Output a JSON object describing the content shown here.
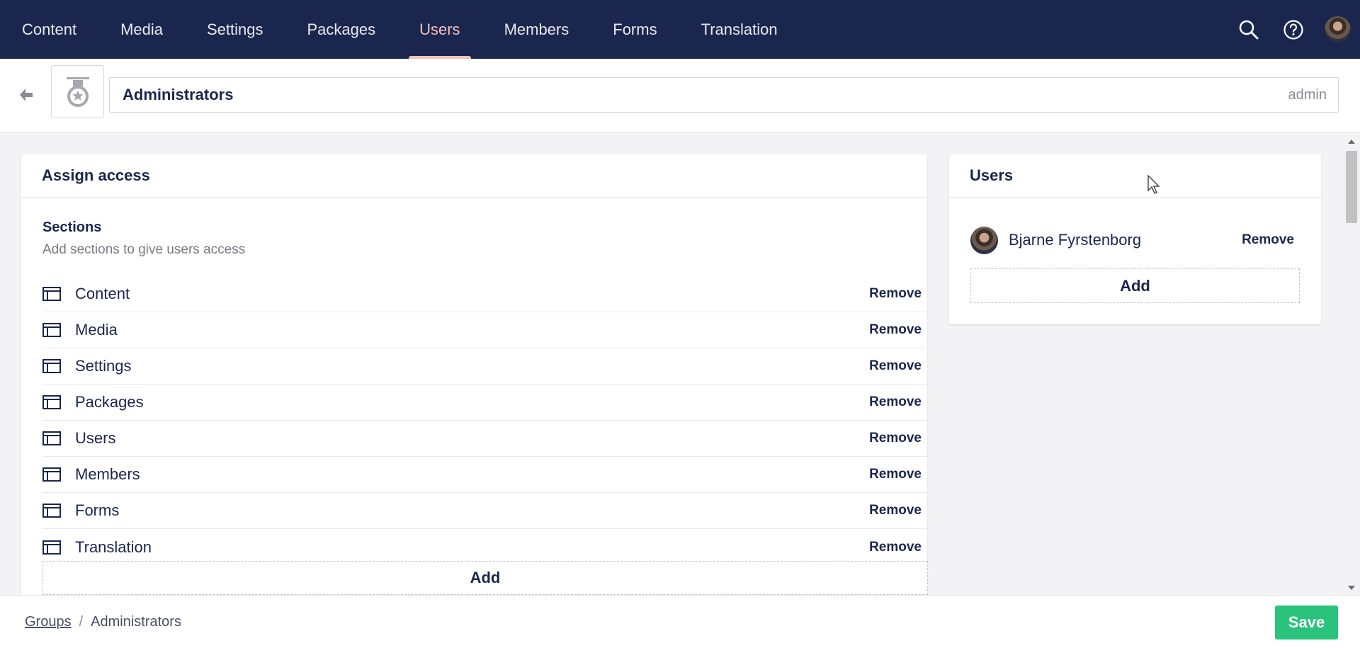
{
  "nav": {
    "items": [
      {
        "label": "Content"
      },
      {
        "label": "Media"
      },
      {
        "label": "Settings"
      },
      {
        "label": "Packages"
      },
      {
        "label": "Users",
        "active": true
      },
      {
        "label": "Members"
      },
      {
        "label": "Forms"
      },
      {
        "label": "Translation"
      }
    ],
    "icons": [
      "search-icon",
      "help-icon",
      "user-avatar"
    ]
  },
  "header": {
    "group_name": "Administrators",
    "alias": "admin",
    "group_icon": "medal-icon"
  },
  "access_panel": {
    "title": "Assign access",
    "sections_title": "Sections",
    "sections_description": "Add sections to give users access",
    "sections": [
      {
        "label": "Content",
        "action": "Remove"
      },
      {
        "label": "Media",
        "action": "Remove"
      },
      {
        "label": "Settings",
        "action": "Remove"
      },
      {
        "label": "Packages",
        "action": "Remove"
      },
      {
        "label": "Users",
        "action": "Remove"
      },
      {
        "label": "Members",
        "action": "Remove"
      },
      {
        "label": "Forms",
        "action": "Remove"
      },
      {
        "label": "Translation",
        "action": "Remove"
      }
    ],
    "add_label": "Add"
  },
  "users_panel": {
    "title": "Users",
    "users": [
      {
        "name": "Bjarne Fyrstenborg",
        "action": "Remove"
      }
    ],
    "add_label": "Add"
  },
  "footer": {
    "breadcrumb": [
      {
        "label": "Groups",
        "link": true
      },
      {
        "label": "Administrators",
        "link": false
      }
    ],
    "save_label": "Save"
  },
  "colors": {
    "nav_bg": "#1b264f",
    "nav_active": "#f5c1bc",
    "save_green": "#2bc37c",
    "text_dark": "#1b264f"
  }
}
